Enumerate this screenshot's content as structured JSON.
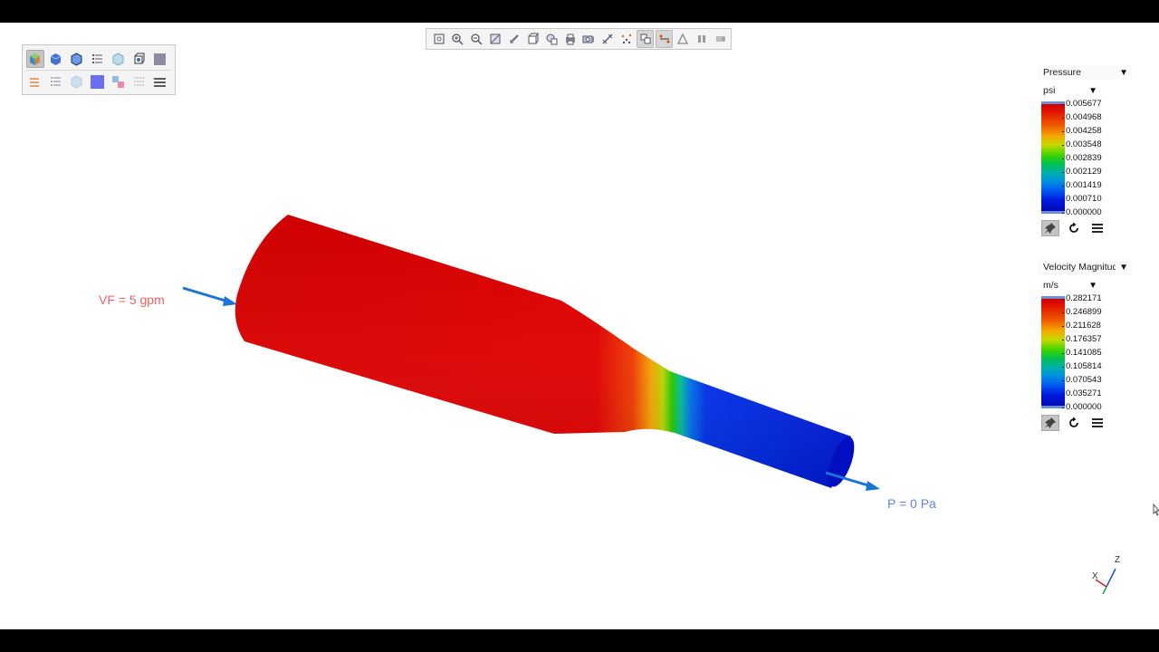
{
  "colors": {
    "pipe_red": "#e00000",
    "pipe_blue": "#0018e0",
    "inlet_label": "#f06060",
    "outlet_label": "#6080f0",
    "arrow_blue": "#1a73d8",
    "toolbar_bg": "#f4f4f4"
  },
  "toolbar_top": {
    "buttons": [
      {
        "name": "fit-view-icon"
      },
      {
        "name": "zoom-in-icon"
      },
      {
        "name": "zoom-out-icon"
      },
      {
        "name": "zoom-box-icon"
      },
      {
        "name": "rotate-icon"
      },
      {
        "name": "view-cube-icon"
      },
      {
        "name": "view-orient-icon"
      },
      {
        "name": "print-icon"
      },
      {
        "name": "camera-icon"
      },
      {
        "name": "measure-icon"
      },
      {
        "name": "scatter-icon"
      },
      {
        "name": "probe-icon",
        "active": true
      },
      {
        "name": "streamline-icon",
        "active": true
      },
      {
        "name": "warning-triangle-icon"
      },
      {
        "name": "pause-icon"
      },
      {
        "name": "record-icon"
      }
    ]
  },
  "toolbar_left": {
    "row1": [
      {
        "name": "shaded-cube-icon",
        "active": true
      },
      {
        "name": "blue-cube-icon"
      },
      {
        "name": "outline-cube-icon"
      },
      {
        "name": "list-icon"
      },
      {
        "name": "transparent-cube-icon"
      },
      {
        "name": "section-cube-icon"
      },
      {
        "name": "grey-square-icon"
      }
    ],
    "row2": [
      {
        "name": "vector-arrows-icon"
      },
      {
        "name": "stack-list-icon"
      },
      {
        "name": "faded-cube-icon"
      },
      {
        "name": "blue-square-icon"
      },
      {
        "name": "split-color-icon"
      },
      {
        "name": "dotted-list-icon"
      },
      {
        "name": "menu-lines-icon"
      }
    ]
  },
  "legends": {
    "pressure": {
      "title": "Pressure",
      "unit": "psi",
      "ticks": [
        "0.005677",
        "0.004968",
        "0.004258",
        "0.003548",
        "0.002839",
        "0.002129",
        "0.001419",
        "0.000710",
        "0.000000"
      ]
    },
    "velocity": {
      "title": "Velocity Magnitude",
      "unit": "m/s",
      "ticks": [
        "0.282171",
        "0.246899",
        "0.211628",
        "0.176357",
        "0.141085",
        "0.105814",
        "0.070543",
        "0.035271",
        "0.000000"
      ]
    }
  },
  "annotations": {
    "inlet": "VF = 5 gpm",
    "outlet": "P = 0 Pa"
  },
  "triad": {
    "x": "X",
    "z": "Z"
  }
}
